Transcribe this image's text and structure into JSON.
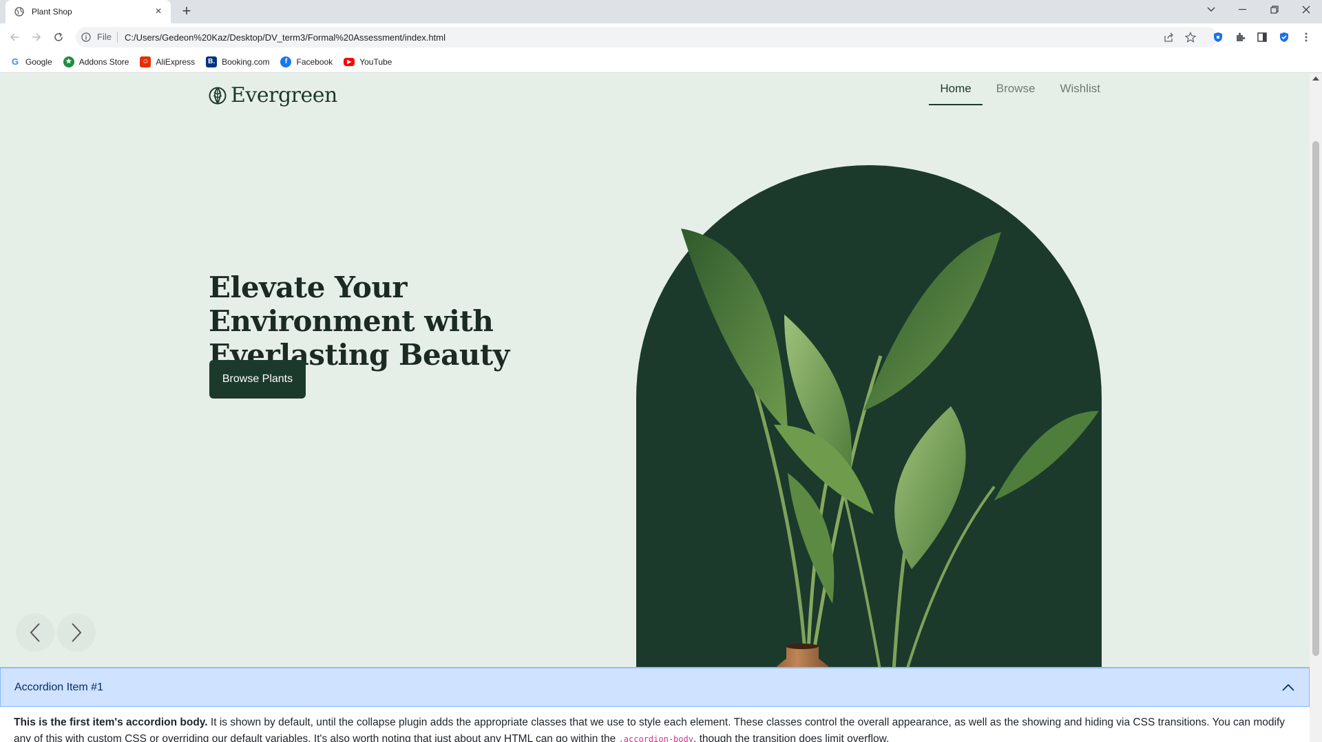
{
  "browser": {
    "tab_title": "Plant Shop",
    "scheme_label": "File",
    "url": "C:/Users/Gedeon%20Kaz/Desktop/DV_term3/Formal%20Assessment/index.html",
    "bookmarks": [
      {
        "label": "Google",
        "icon": "google-icon",
        "color": "#4285f4"
      },
      {
        "label": "Addons Store",
        "icon": "addons-store-icon",
        "color": "#1e8e3e"
      },
      {
        "label": "AliExpress",
        "icon": "aliexpress-icon",
        "color": "#e62e04"
      },
      {
        "label": "Booking.com",
        "icon": "booking-icon",
        "color": "#003580"
      },
      {
        "label": "Facebook",
        "icon": "facebook-icon",
        "color": "#1877f2"
      },
      {
        "label": "YouTube",
        "icon": "youtube-icon",
        "color": "#ff0000"
      }
    ]
  },
  "site": {
    "brand": "Evergreen",
    "nav": [
      {
        "label": "Home",
        "active": true
      },
      {
        "label": "Browse",
        "active": false
      },
      {
        "label": "Wishlist",
        "active": false
      }
    ],
    "hero": {
      "title": "Elevate Your Environment with Everlasting Beauty",
      "cta": "Browse Plants"
    },
    "accordion": {
      "title": "Accordion Item #1",
      "body_strong": "This is the first item's accordion body.",
      "body_text": " It is shown by default, until the collapse plugin adds the appropriate classes that we use to style each element. These classes control the overall appearance, as well as the showing and hiding via CSS transitions. You can modify any of this with custom CSS or overriding our default variables. It's also worth noting that just about any HTML can go within the ",
      "body_code": ".accordion-body",
      "body_tail": ", though the transition does limit overflow."
    }
  },
  "colors": {
    "page_bg": "#e6efe7",
    "brand_dark": "#1b3a2c",
    "accordion_header_bg": "#cfe2ff"
  }
}
